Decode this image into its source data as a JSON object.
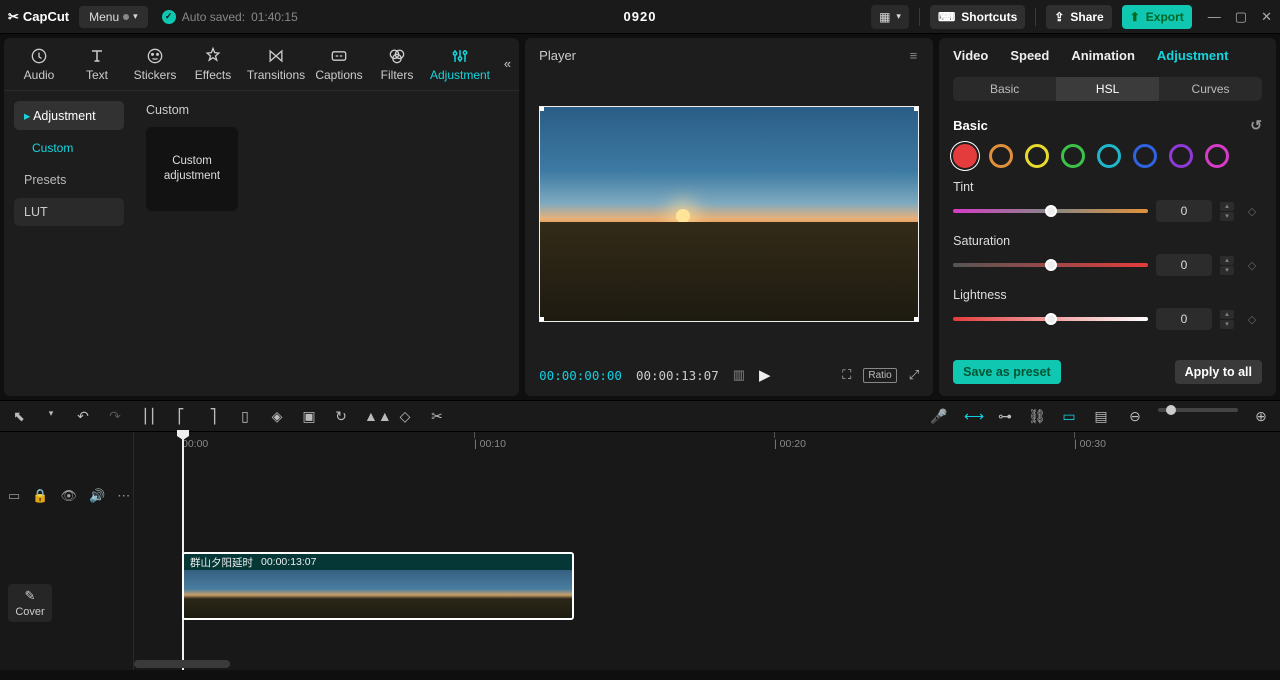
{
  "topbar": {
    "brand": "CapCut",
    "menu_label": "Menu",
    "autosave_label": "Auto saved:",
    "autosave_time": "01:40:15",
    "project_name": "0920",
    "shortcuts_label": "Shortcuts",
    "share_label": "Share",
    "export_label": "Export"
  },
  "mediatabs": {
    "audio": "Audio",
    "text": "Text",
    "stickers": "Stickers",
    "effects": "Effects",
    "transitions": "Transitions",
    "captions": "Captions",
    "filters": "Filters",
    "adjustment": "Adjustment"
  },
  "subnav": {
    "adjustment": "Adjustment",
    "custom": "Custom",
    "presets": "Presets",
    "lut": "LUT"
  },
  "leftcontent": {
    "heading": "Custom",
    "card": "Custom adjustment"
  },
  "player": {
    "title": "Player",
    "current_tc": "00:00:00:00",
    "duration_tc": "00:00:13:07",
    "ratio_label": "Ratio"
  },
  "inspector": {
    "tabs": {
      "video": "Video",
      "speed": "Speed",
      "animation": "Animation",
      "adjustment": "Adjustment"
    },
    "subtabs": {
      "basic": "Basic",
      "hsl": "HSL",
      "curves": "Curves"
    },
    "section_title": "Basic",
    "swatches": [
      "#e43c3c",
      "#e0903a",
      "#e7db2e",
      "#3cc24a",
      "#1fb6c9",
      "#2f63e0",
      "#8f3ad6",
      "#d63cc7"
    ],
    "params": {
      "tint": {
        "label": "Tint",
        "value": "0"
      },
      "saturation": {
        "label": "Saturation",
        "value": "0"
      },
      "lightness": {
        "label": "Lightness",
        "value": "0"
      }
    },
    "save_preset": "Save as preset",
    "apply_all": "Apply to all"
  },
  "ruler": {
    "t0": "00:00",
    "t10": "| 00:10",
    "t20": "| 00:20",
    "t30": "| 00:30"
  },
  "clip": {
    "name": "群山夕阳延时",
    "duration": "00:00:13:07"
  },
  "cover_label": "Cover"
}
